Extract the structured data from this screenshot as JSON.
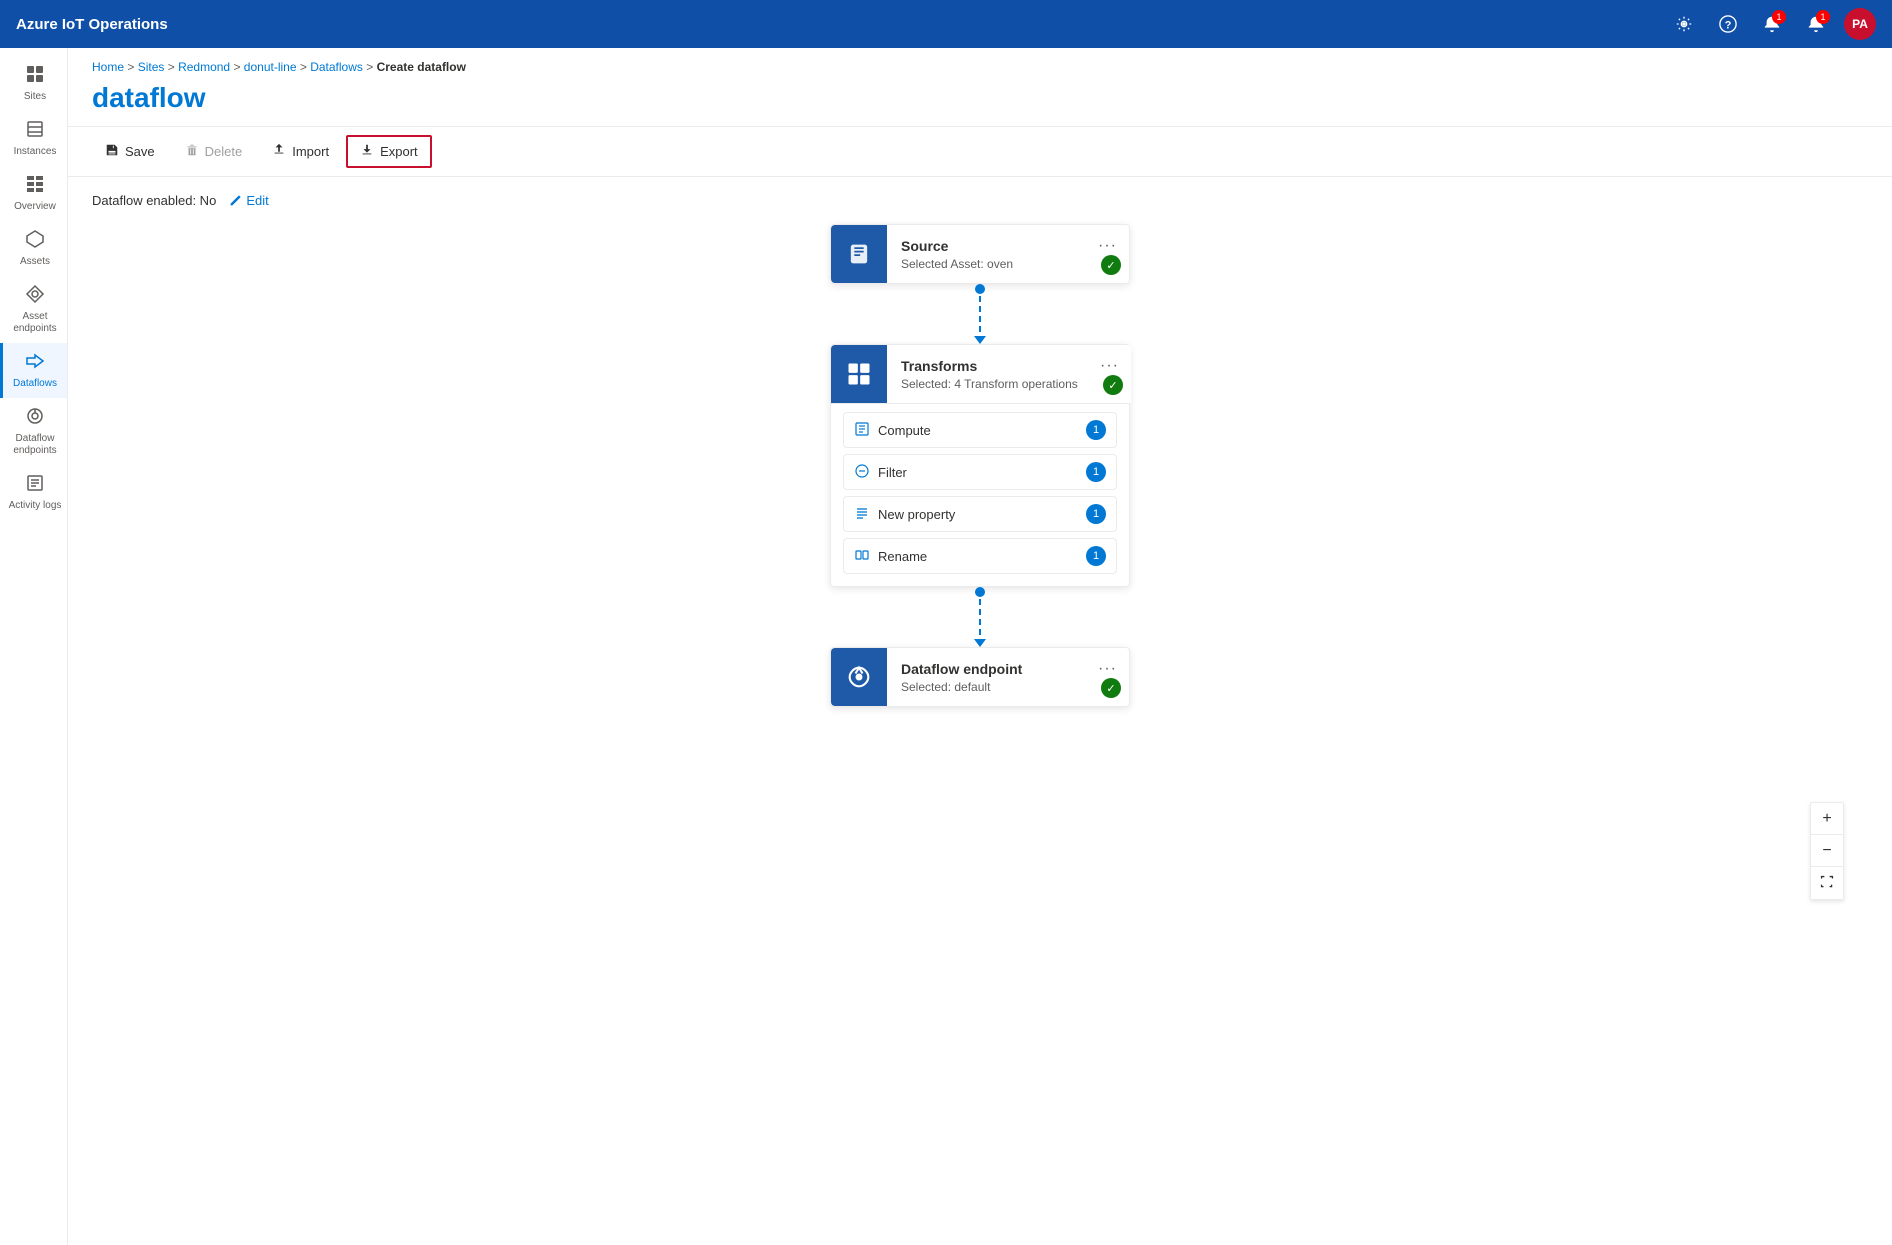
{
  "app": {
    "title": "Azure IoT Operations"
  },
  "topnav": {
    "title": "Azure IoT Operations",
    "icons": {
      "settings": "⚙",
      "help": "?",
      "alerts1": "🔔",
      "alerts1_badge": "1",
      "alerts2": "🔔",
      "alerts2_badge": "1",
      "avatar": "PA"
    }
  },
  "sidebar": {
    "items": [
      {
        "id": "sites",
        "label": "Sites",
        "icon": "⊞"
      },
      {
        "id": "instances",
        "label": "Instances",
        "icon": "⬚"
      },
      {
        "id": "overview",
        "label": "Overview",
        "icon": "▦"
      },
      {
        "id": "assets",
        "label": "Assets",
        "icon": "◈"
      },
      {
        "id": "asset-endpoints",
        "label": "Asset endpoints",
        "icon": "⬡"
      },
      {
        "id": "dataflows",
        "label": "Dataflows",
        "icon": "⇄",
        "active": true
      },
      {
        "id": "dataflow-endpoints",
        "label": "Dataflow endpoints",
        "icon": "⬡"
      },
      {
        "id": "activity-logs",
        "label": "Activity logs",
        "icon": "≡"
      }
    ]
  },
  "breadcrumb": {
    "parts": [
      "Home",
      "Sites",
      "Redmond",
      "donut-line",
      "Dataflows",
      "Create dataflow"
    ],
    "separators": [
      " > ",
      " > ",
      " > ",
      " > ",
      " > "
    ]
  },
  "page": {
    "title": "dataflow"
  },
  "toolbar": {
    "save": "Save",
    "delete": "Delete",
    "import": "Import",
    "export": "Export"
  },
  "dataflow": {
    "status_label": "Dataflow enabled: No",
    "edit_label": "Edit"
  },
  "nodes": {
    "source": {
      "title": "Source",
      "subtitle": "Selected Asset: oven",
      "icon": "📦"
    },
    "transforms": {
      "title": "Transforms",
      "subtitle": "Selected: 4 Transform operations",
      "icon": "⊞",
      "items": [
        {
          "label": "Compute",
          "count": "1",
          "icon": "📋"
        },
        {
          "label": "Filter",
          "count": "1",
          "icon": "⊜"
        },
        {
          "label": "New property",
          "count": "1",
          "icon": "≡"
        },
        {
          "label": "Rename",
          "count": "1",
          "icon": "📊"
        }
      ]
    },
    "endpoint": {
      "title": "Dataflow endpoint",
      "subtitle": "Selected: default",
      "icon": "⟳"
    }
  },
  "zoom": {
    "plus": "+",
    "minus": "−",
    "fit": "⤢"
  }
}
